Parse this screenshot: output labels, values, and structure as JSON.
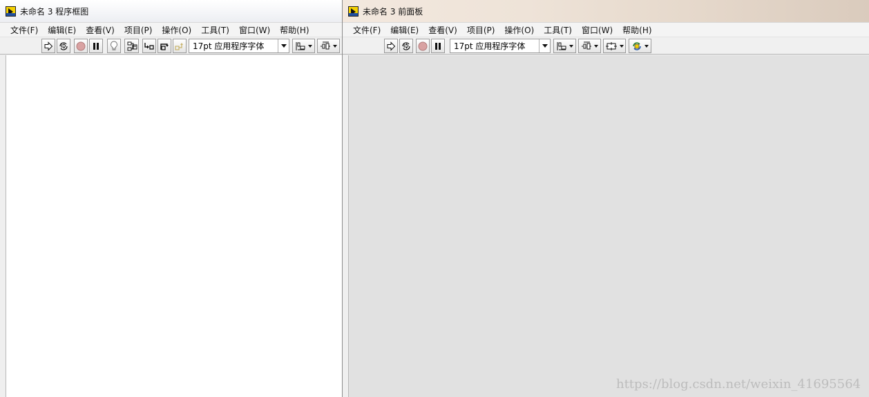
{
  "block_diagram": {
    "title": "未命名 3 程序框图",
    "menu": [
      "文件(F)",
      "编辑(E)",
      "查看(V)",
      "项目(P)",
      "操作(O)",
      "工具(T)",
      "窗口(W)",
      "帮助(H)"
    ],
    "font_selector": "17pt 应用程序字体"
  },
  "front_panel": {
    "title": "未命名 3 前面板",
    "menu": [
      "文件(F)",
      "编辑(E)",
      "查看(V)",
      "项目(P)",
      "操作(O)",
      "工具(T)",
      "窗口(W)",
      "帮助(H)"
    ],
    "font_selector": "17pt 应用程序字体"
  },
  "watermark": "https://blog.csdn.net/weixin_41695564",
  "colors": {
    "block_diagram_bg": "#ffffff",
    "front_panel_bg": "#e1e1e1",
    "labview_icon": "#f4d000"
  },
  "icons": {
    "run": "run-arrow-icon",
    "run_continuous": "run-continuously-icon",
    "abort": "abort-icon",
    "pause": "pause-icon",
    "highlight": "lightbulb-icon",
    "retain_wire": "retain-wire-values-icon",
    "step_into": "step-into-icon",
    "step_over": "step-over-icon",
    "step_out": "step-out-icon",
    "align": "align-objects-icon",
    "distribute": "distribute-objects-icon",
    "resize": "resize-objects-icon",
    "reorder": "reorder-icon"
  }
}
